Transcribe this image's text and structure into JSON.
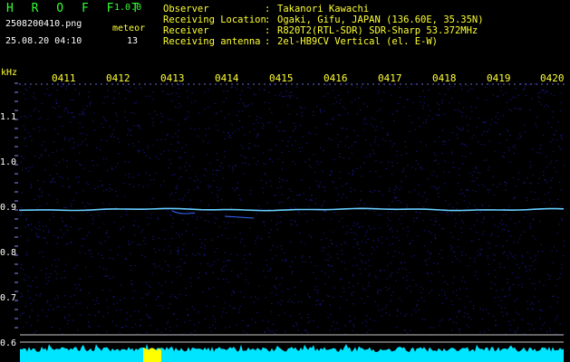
{
  "header": {
    "app_name": "H R O F F T",
    "app_version": "1.0.0",
    "file_name": "2508200410.png",
    "timestamp": "25.08.20 04:10",
    "meteor_label": "meteor",
    "meteor_count": "13"
  },
  "info": [
    {
      "key": "Observer",
      "sep": ":",
      "value": "Takanori Kawachi"
    },
    {
      "key": "Receiving Location",
      "sep": ":",
      "value": "Ogaki, Gifu, JAPAN (136.60E, 35.35N)"
    },
    {
      "key": "Receiver",
      "sep": ":",
      "value": "R820T2(RTL-SDR) SDR-Sharp 53.372MHz"
    },
    {
      "key": "Receiving antenna",
      "sep": ":",
      "value": "2el-HB9CV Vertical (el. E-W)"
    }
  ],
  "axis": {
    "unit_label": "kHz",
    "time_labels": [
      "0411",
      "0412",
      "0413",
      "0414",
      "0415",
      "0416",
      "0417",
      "0418",
      "0419",
      "0420"
    ],
    "freq_labels": [
      "1.1",
      "1.0",
      "0.9",
      "0.8",
      "0.7",
      "0.6"
    ]
  },
  "colors": {
    "background": "#000000",
    "noise": "#1a1aa0",
    "carrier": "#66ccff",
    "level_bar": "#00e5ff",
    "meteor_burst": "#ffff00",
    "grid": "#c8c8c8",
    "text_green": "#33ff33",
    "text_yellow": "#ffff33"
  }
}
